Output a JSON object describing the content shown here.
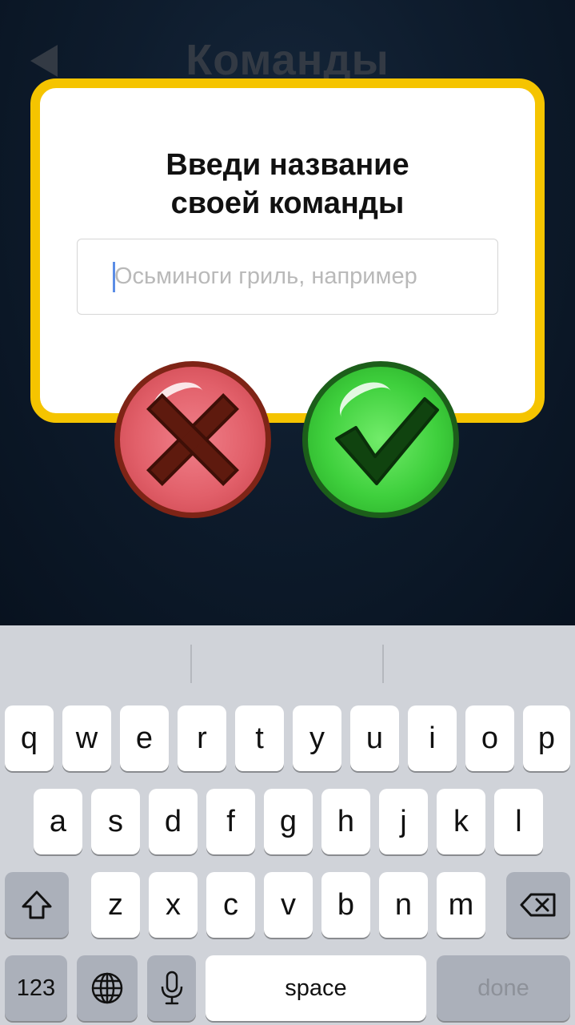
{
  "background": {
    "title": "Команды",
    "back_icon": "back-arrow-icon"
  },
  "dialog": {
    "title": "Введи название\nсвоей команды",
    "input": {
      "value": "",
      "placeholder": "Осьминоги гриль, например"
    },
    "cancel_icon": "cross-icon",
    "confirm_icon": "checkmark-icon",
    "colors": {
      "frame": "#f5c400",
      "cancel": "#e2606a",
      "confirm": "#3fd03d"
    }
  },
  "keyboard": {
    "row1": [
      "q",
      "w",
      "e",
      "r",
      "t",
      "y",
      "u",
      "i",
      "o",
      "p"
    ],
    "row2": [
      "a",
      "s",
      "d",
      "f",
      "g",
      "h",
      "j",
      "k",
      "l"
    ],
    "row3": [
      "z",
      "x",
      "c",
      "v",
      "b",
      "n",
      "m"
    ],
    "shift_icon": "shift-icon",
    "backspace_icon": "backspace-icon",
    "numbers_label": "123",
    "globe_icon": "globe-icon",
    "mic_icon": "microphone-icon",
    "space_label": "space",
    "done_label": "done"
  }
}
